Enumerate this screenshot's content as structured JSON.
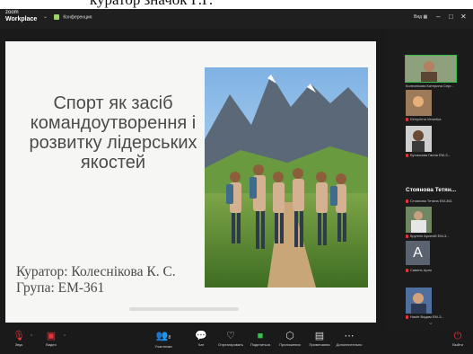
{
  "caption_text": "куратор значок Г.Г.",
  "titlebar": {
    "logo_line1": "zoom",
    "logo_line2": "Workplace",
    "meeting_title": "Конференция",
    "view_label": "Вид",
    "min_glyph": "–",
    "max_glyph": "□",
    "close_glyph": "✕"
  },
  "slide": {
    "title": "Спорт як засіб командоутворення і розвитку лідерських якостей",
    "curator": "Куратор: Колеснікова К. С.",
    "group": "Група: ЕМ-361"
  },
  "participants": [
    {
      "label": "Колеснікова Катерина Серг..."
    },
    {
      "label": "Kirnychna Veronika"
    },
    {
      "label": "Бутасьєва Ганна EM-3..."
    },
    {
      "bold_name": "Стоянова Тетян...",
      "label": "Стоянова Тетяна EM-361"
    },
    {
      "label": "Крупнін Арсеній EM-3..."
    },
    {
      "avatar_letter": "A",
      "label": "Сивень Арно"
    },
    {
      "label": "Hasfe Вадим EM-3..."
    }
  ],
  "toolbar": {
    "audio": "Звук",
    "video": "Видео",
    "participants": "Участники",
    "participants_count": "8",
    "chat": "Чат",
    "react": "Отреагировать",
    "share": "Поделиться",
    "apps": "Приложения",
    "notes": "Примечания",
    "more": "Дополнительно",
    "leave": "Выйти"
  },
  "colors": {
    "background": "#1a1a1a",
    "slide_bg": "#f6f6f4",
    "accent_green": "#2ec14f",
    "muted_red": "#e0343a"
  }
}
